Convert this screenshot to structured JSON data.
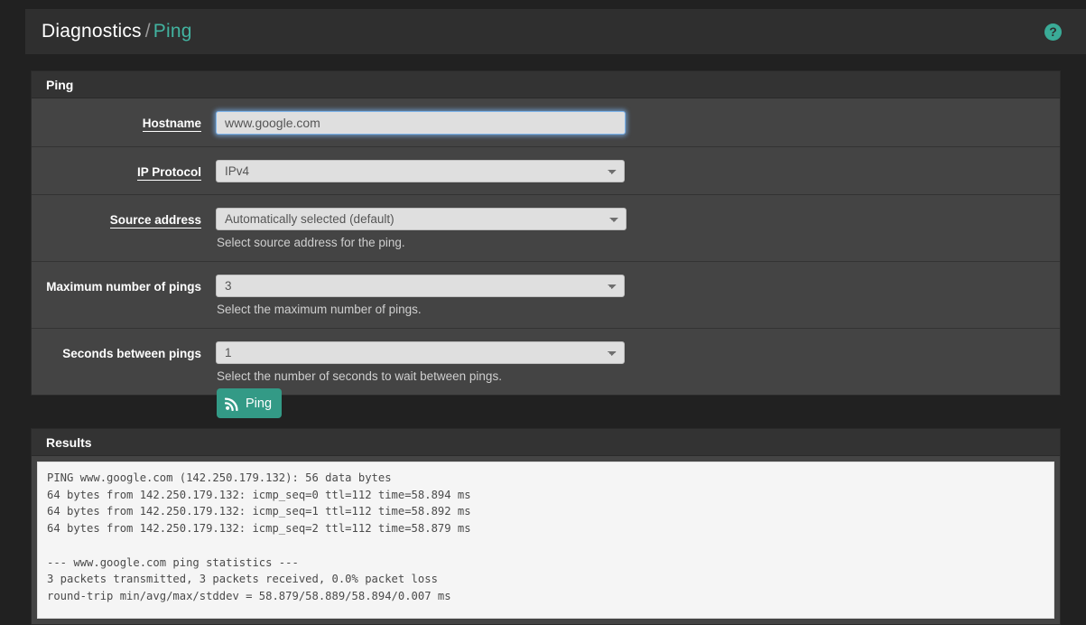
{
  "header": {
    "breadcrumb_parent": "Diagnostics",
    "breadcrumb_separator": "/",
    "breadcrumb_current": "Ping",
    "help_icon_glyph": "?",
    "accent_color": "#42b3a0"
  },
  "ping_panel": {
    "title": "Ping",
    "fields": {
      "hostname": {
        "label": "Hostname",
        "value": "www.google.com",
        "placeholder": "Hostname"
      },
      "ip_protocol": {
        "label": "IP Protocol",
        "value": "IPv4"
      },
      "source_address": {
        "label": "Source address",
        "value": "Automatically selected (default)",
        "help": "Select source address for the ping."
      },
      "max_pings": {
        "label": "Maximum number of pings",
        "value": "3",
        "help": "Select the maximum number of pings."
      },
      "seconds_between": {
        "label": "Seconds between pings",
        "value": "1",
        "help": "Select the number of seconds to wait between pings."
      }
    }
  },
  "actions": {
    "ping_button_label": "Ping",
    "ping_button_icon": "rss-signal-icon",
    "ping_button_color": "#339a86"
  },
  "results_panel": {
    "title": "Results",
    "output": "PING www.google.com (142.250.179.132): 56 data bytes\n64 bytes from 142.250.179.132: icmp_seq=0 ttl=112 time=58.894 ms\n64 bytes from 142.250.179.132: icmp_seq=1 ttl=112 time=58.892 ms\n64 bytes from 142.250.179.132: icmp_seq=2 ttl=112 time=58.879 ms\n\n--- www.google.com ping statistics ---\n3 packets transmitted, 3 packets received, 0.0% packet loss\nround-trip min/avg/max/stddev = 58.879/58.889/58.894/0.007 ms"
  }
}
